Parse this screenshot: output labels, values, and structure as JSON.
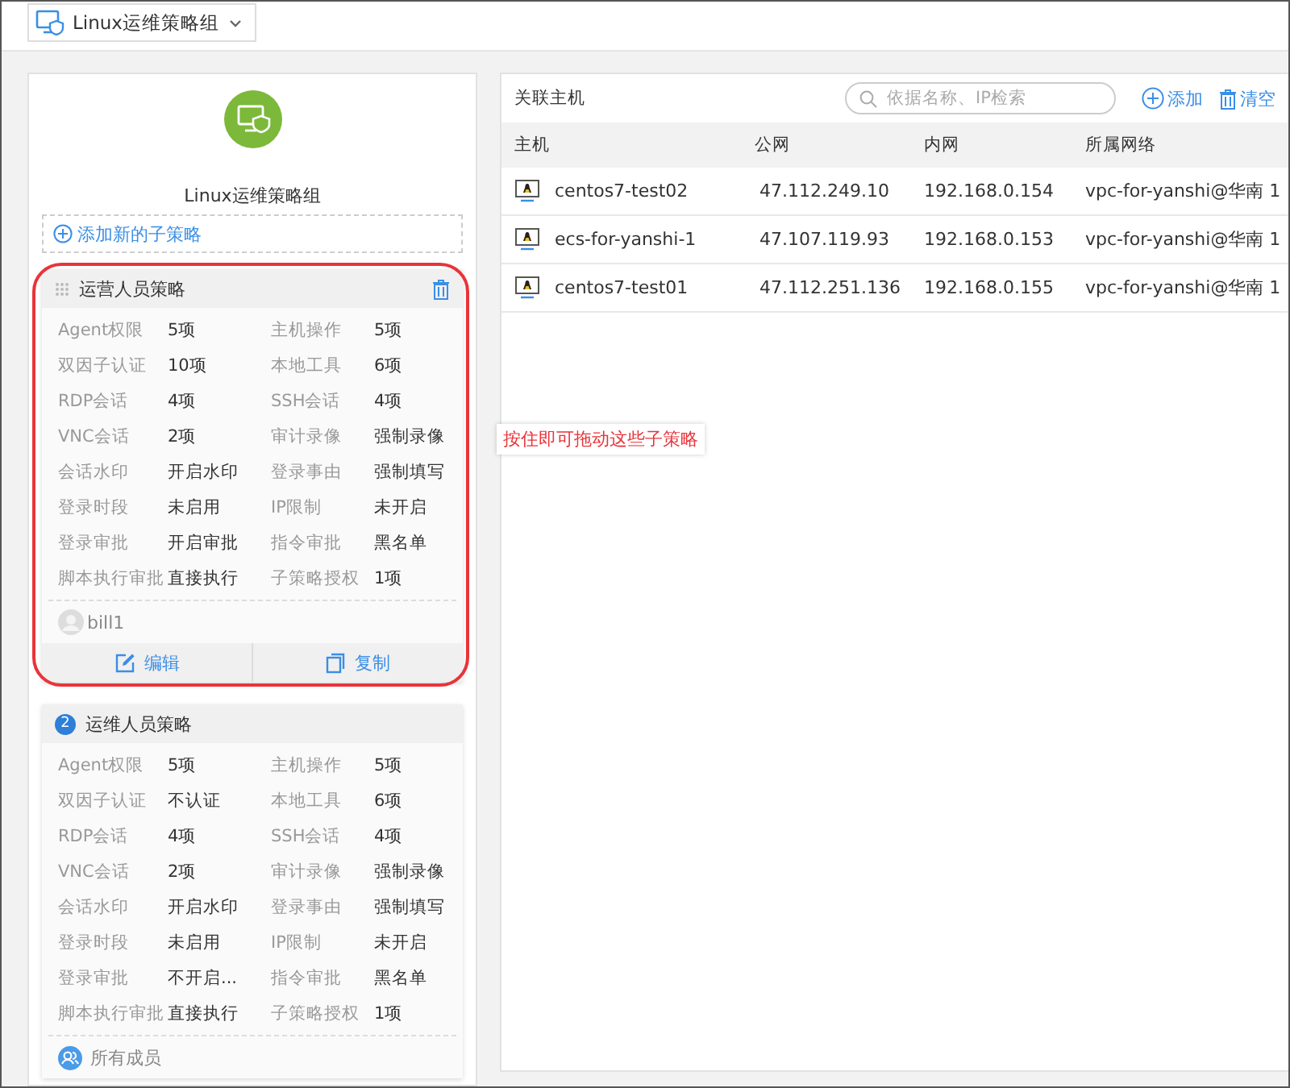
{
  "group_selector": {
    "label": "Linux运维策略组"
  },
  "group": {
    "name": "Linux运维策略组",
    "add_label": "添加新的子策略"
  },
  "annotation": {
    "text": "按住即可拖动这些子策略"
  },
  "policies": [
    {
      "kind": "draggable",
      "title": "运营人员策略",
      "highlighted": true,
      "rows": [
        [
          "Agent权限",
          "5项",
          "主机操作",
          "5项"
        ],
        [
          "双因子认证",
          "10项",
          "本地工具",
          "6项"
        ],
        [
          "RDP会话",
          "4项",
          "SSH会话",
          "4项"
        ],
        [
          "VNC会话",
          "2项",
          "审计录像",
          "强制录像"
        ],
        [
          "会话水印",
          "开启水印",
          "登录事由",
          "强制填写"
        ],
        [
          "登录时段",
          "未启用",
          "IP限制",
          "未开启"
        ],
        [
          "登录审批",
          "开启审批",
          "指令审批",
          "黑名单"
        ],
        [
          "脚本执行审批",
          "直接执行",
          "子策略授权",
          "1项"
        ]
      ],
      "owner": "bill1",
      "buttons": [
        "编辑",
        "复制"
      ]
    },
    {
      "kind": "numbered",
      "number": "2",
      "title": "运维人员策略",
      "highlighted": false,
      "rows": [
        [
          "Agent权限",
          "5项",
          "主机操作",
          "5项"
        ],
        [
          "双因子认证",
          "不认证",
          "本地工具",
          "6项"
        ],
        [
          "RDP会话",
          "4项",
          "SSH会话",
          "4项"
        ],
        [
          "VNC会话",
          "2项",
          "审计录像",
          "强制录像"
        ],
        [
          "会话水印",
          "开启水印",
          "登录事由",
          "强制填写"
        ],
        [
          "登录时段",
          "未启用",
          "IP限制",
          "未开启"
        ],
        [
          "登录审批",
          "不开启...",
          "指令审批",
          "黑名单"
        ],
        [
          "脚本执行审批",
          "直接执行",
          "子策略授权",
          "1项"
        ]
      ],
      "members": "所有成员"
    }
  ],
  "hosts_panel": {
    "title": "关联主机",
    "search": {
      "placeholder": "依据名称、IP检索"
    },
    "add_label": "添加",
    "clear_label": "清空"
  },
  "table": {
    "columns": [
      "主机",
      "公网",
      "内网",
      "所属网络"
    ],
    "rows": [
      [
        "centos7-test02",
        "47.112.249.10",
        "192.168.0.154",
        "vpc-for-yanshi@华南 1"
      ],
      [
        "ecs-for-yanshi-1",
        "47.107.119.93",
        "192.168.0.153",
        "vpc-for-yanshi@华南 1"
      ],
      [
        "centos7-test01",
        "47.112.251.136",
        "192.168.0.155",
        "vpc-for-yanshi@华南 1"
      ]
    ]
  }
}
